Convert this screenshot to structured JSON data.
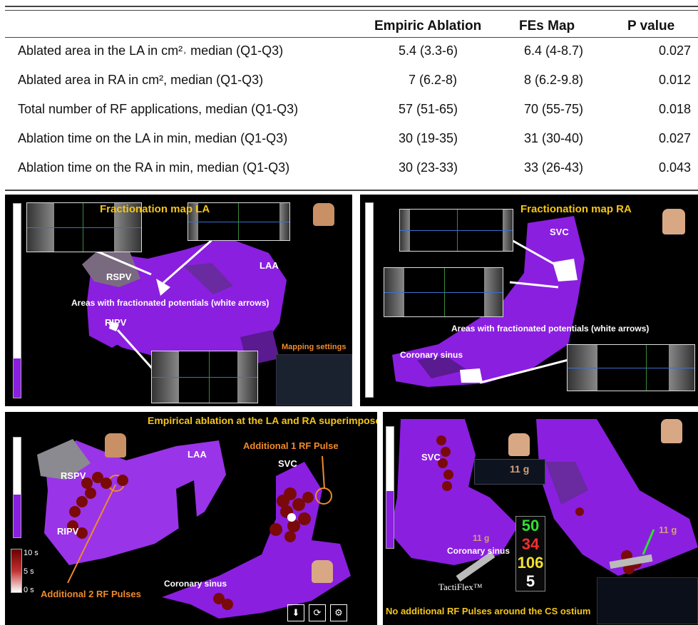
{
  "table": {
    "headers": {
      "col_emp": "Empiric Ablation",
      "col_fes": "FEs Map",
      "col_p": "P value"
    },
    "rows": [
      {
        "label": "Ablated area in the LA in cm²˒ median (Q1-Q3)",
        "emp": "5.4 (3.3-6)",
        "fes": "6.4 (4-8.7)",
        "p": "0.027"
      },
      {
        "label": "Ablated area in RA in cm², median (Q1-Q3)",
        "emp": "7 (6.2-8)",
        "fes": "8 (6.2-9.8)",
        "p": "0.012"
      },
      {
        "label": "Total number of RF applications, median (Q1-Q3)",
        "emp": "57 (51-65)",
        "fes": "70 (55-75)",
        "p": "0.018"
      },
      {
        "label": "Ablation time on the LA in min, median (Q1-Q3)",
        "emp": "30 (19-35)",
        "fes": "31 (30-40)",
        "p": "0.027"
      },
      {
        "label": "Ablation time on the RA in min, median (Q1-Q3)",
        "emp": "30 (23-33)",
        "fes": "33 (26-43)",
        "p": "0.043"
      }
    ]
  },
  "panel_la": {
    "title": "Fractionation map LA",
    "label_rspv": "RSPV",
    "label_ripv": "RIPV",
    "label_laa": "LAA",
    "annotation": "Areas with fractionated potentials (white arrows)",
    "mapping_settings": "Mapping settings"
  },
  "panel_ra": {
    "title": "Fractionation map RA",
    "label_svc": "SVC",
    "label_cs": "Coronary sinus",
    "annotation": "Areas with fractionated potentials (white arrows)"
  },
  "panel_emp": {
    "title": "Empirical ablation at the LA and RA superimposed on the fractionation map",
    "label_rspv": "RSPV",
    "label_ripv": "RIPV",
    "label_laa": "LAA",
    "label_svc": "SVC",
    "label_cs": "Coronary sinus",
    "additional_1": "Additional 1 RF Pulse",
    "additional_2": "Additional 2 RF Pulses",
    "scale_10s": "10 s",
    "scale_5s": "5 s",
    "scale_0s": "0 s"
  },
  "panel_tacti": {
    "label_svc": "SVC",
    "label_cs": "Coronary sinus",
    "catheter_name": "TactiFlex™",
    "force_left": "11 g",
    "force_right": "11 g",
    "force_top": "11 g",
    "readout_1": "50",
    "readout_2": "34",
    "readout_3": "106",
    "readout_4": "5",
    "caption": "No additional RF Pulses around the CS ostium"
  },
  "colors": {
    "accent_yellow": "#f5c518",
    "orange": "#f08a2a",
    "purple": "#8a1fe0",
    "lesion": "#7a0a0a"
  },
  "icons": [
    "torso-icon",
    "download-icon",
    "rotate-icon",
    "settings-icon"
  ]
}
